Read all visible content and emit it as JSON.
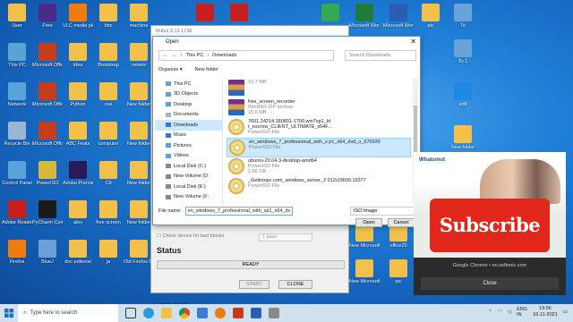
{
  "desktop": {
    "icons": [
      {
        "label": "User",
        "color": "#f3c04a"
      },
      {
        "label": "Free",
        "color": "#4a2a8a"
      },
      {
        "label": "VLC media player",
        "color": "#f07c10"
      },
      {
        "label": "bbc",
        "color": "#f3c04a"
      },
      {
        "label": "machine",
        "color": "#f3c04a"
      },
      {
        "label": "This PC",
        "color": "#5aa3d8"
      },
      {
        "label": "Microsoft Office",
        "color": "#c43e1c"
      },
      {
        "label": "Idea",
        "color": "#f3c04a"
      },
      {
        "label": "Bootstrap",
        "color": "#f3c04a"
      },
      {
        "label": "networ",
        "color": "#f3c04a"
      },
      {
        "label": "Network",
        "color": "#5aa3d8"
      },
      {
        "label": "Microsoft Office",
        "color": "#c43e1c"
      },
      {
        "label": "Python",
        "color": "#f3c04a"
      },
      {
        "label": "cse",
        "color": "#f3c04a"
      },
      {
        "label": "New folder",
        "color": "#f3c04a"
      },
      {
        "label": "Recycle Bin",
        "color": "#9bb7cf"
      },
      {
        "label": "Microsoft Office",
        "color": "#c43e1c"
      },
      {
        "label": "ABC Feats",
        "color": "#f3c04a"
      },
      {
        "label": "computer",
        "color": "#f3c04a"
      },
      {
        "label": "New folder",
        "color": "#f3c04a"
      },
      {
        "label": "Control Panel",
        "color": "#5aa3d8"
      },
      {
        "label": "PowerISO",
        "color": "#d6b83a"
      },
      {
        "label": "Adobe Premiere",
        "color": "#2a1a5a"
      },
      {
        "label": "Cd",
        "color": "#f3c04a"
      },
      {
        "label": "New folder",
        "color": "#f3c04a"
      },
      {
        "label": "Adobe Reader XI",
        "color": "#c81e1e"
      },
      {
        "label": "PyCharm Community",
        "color": "#1a1a1a"
      },
      {
        "label": "alex",
        "color": "#f3c04a"
      },
      {
        "label": "free screen",
        "color": "#f3c04a"
      },
      {
        "label": "New folder",
        "color": "#f3c04a"
      },
      {
        "label": "Firefox",
        "color": "#f07c10"
      },
      {
        "label": "BlueJ",
        "color": "#6aa2d8"
      },
      {
        "label": "doc editorial",
        "color": "#f3c04a"
      },
      {
        "label": "ja",
        "color": "#f3c04a"
      },
      {
        "label": "Old Firefox Data",
        "color": "#f3c04a"
      }
    ],
    "right_icons": [
      {
        "label": "",
        "color": "#c81e1e"
      },
      {
        "label": "",
        "color": "#c81e1e"
      },
      {
        "label": "",
        "color": "#34a853"
      },
      {
        "label": "Microsoft Word Ex",
        "color": "#1e7b3a"
      },
      {
        "label": "Microsoft Word",
        "color": "#2b5db3"
      },
      {
        "label": "pic",
        "color": "#f3c04a"
      },
      {
        "label": "To",
        "color": "#6aa2d8"
      },
      {
        "label": "To 1",
        "color": "#6aa2d8"
      },
      {
        "label": "edit",
        "color": "#1e88e5"
      },
      {
        "label": "New folder",
        "color": "#f3c04a"
      },
      {
        "label": "New Microsoft",
        "color": "#f3c04a"
      },
      {
        "label": "office20",
        "color": "#f3c04a"
      },
      {
        "label": "New Microsoft",
        "color": "#f3c04a"
      },
      {
        "label": "pic",
        "color": "#f3c04a"
      }
    ]
  },
  "rufus": {
    "title": "Rufus 3.13.1730",
    "check_bad_blocks": "Check device for bad blocks",
    "passes": "1 pass",
    "status_heading": "Status",
    "ready": "READY",
    "start": "START",
    "close": "CLOSE",
    "devices_found": "1 device found"
  },
  "open_dialog": {
    "title": "Open",
    "path": [
      "This PC",
      "Downloads"
    ],
    "search_placeholder": "Search Downloads",
    "organize": "Organize ▾",
    "new_folder": "New folder",
    "tree": [
      {
        "label": "This PC",
        "color": "#5aa3d8"
      },
      {
        "label": "3D Objects",
        "color": "#5aa3d8"
      },
      {
        "label": "Desktop",
        "color": "#5aa3d8"
      },
      {
        "label": "Documents",
        "color": "#9bb7cf"
      },
      {
        "label": "Downloads",
        "color": "#2a7ad8",
        "selected": true
      },
      {
        "label": "Music",
        "color": "#2a7ad8"
      },
      {
        "label": "Pictures",
        "color": "#5aa3d8"
      },
      {
        "label": "Videos",
        "color": "#5aa3d8"
      },
      {
        "label": "Local Disk (C:)",
        "color": "#888888"
      },
      {
        "label": "New Volume (D:",
        "color": "#888888"
      },
      {
        "label": "Local Disk (E:)",
        "color": "#888888"
      },
      {
        "label": "New Volume (F:",
        "color": "#888888"
      }
    ],
    "files": [
      {
        "name": "",
        "type": "15.7 MB",
        "zip": true
      },
      {
        "name": "free_screen_recorder",
        "type": "WinRAR ZIP archive",
        "size": "15.6 MB",
        "zip": true
      },
      {
        "name": "7601.24214.180801-1700.win7sp1_ld r_escrow_CLIENT_ULTIMATE_x64F...",
        "type": "PowerISO File"
      },
      {
        "name": "en_windows_7_professional_with_s p1_x64_dvd_u_676939",
        "type": "PowerISO File",
        "selected": true
      },
      {
        "name": "ubuntu-20.04.3-desktop-amd64",
        "type": "PowerISO File",
        "size": "2.86 GB"
      },
      {
        "name": "_Getintopc.com_windows_server_2 012r29600.19377",
        "type": "PowerISO File"
      }
    ],
    "file_name_label": "File name:",
    "file_name_value": "en_windows_7_professional_with_sp1_x64_dv",
    "file_type": "ISO Image",
    "open_button": "Open",
    "cancel_button": "Cancel"
  },
  "notification": {
    "brand": "Whatsmut",
    "subscribe": "Subscribe",
    "source": "Google Chrome • en.softonic.com",
    "close": "Close"
  },
  "taskbar": {
    "search_placeholder": "Type here to search",
    "language": "ENG IN",
    "time": "19:56",
    "date": "16-11-2021"
  }
}
